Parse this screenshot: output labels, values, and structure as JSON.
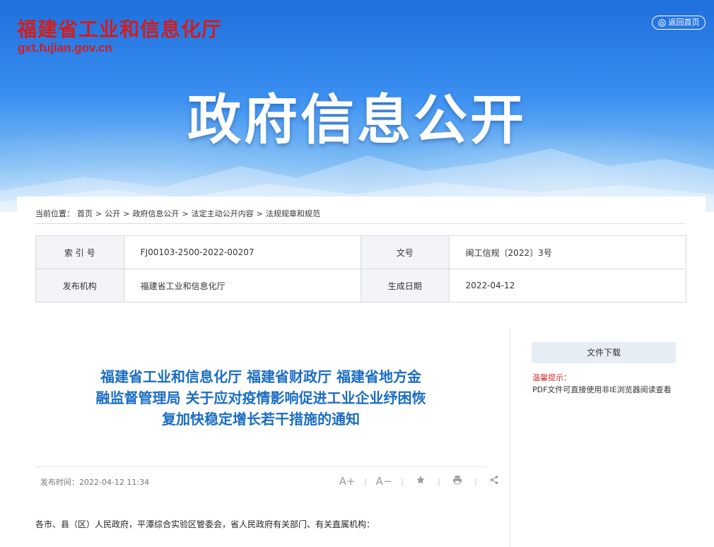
{
  "header": {
    "site_name": "福建省工业和信息化厅",
    "site_domain": "gxt.fujian.gov.cn",
    "home_button": "返回首页",
    "banner_title": "政府信息公开"
  },
  "breadcrumb": {
    "prefix": "当前位置：",
    "items": [
      "首页",
      "公开",
      "政府信息公开",
      "法定主动公开内容",
      "法规规章和规范"
    ],
    "separator": ">"
  },
  "meta_table": {
    "rows": [
      [
        {
          "label": "索 引 号",
          "value": "FJ00103-2500-2022-00207"
        },
        {
          "label": "文号",
          "value": "闽工信规〔2022〕3号"
        }
      ],
      [
        {
          "label": "发布机构",
          "value": "福建省工业和信息化厅"
        },
        {
          "label": "生成日期",
          "value": "2022-04-12"
        }
      ]
    ]
  },
  "article": {
    "title": "福建省工业和信息化厅 福建省财政厅 福建省地方金融监督管理局 关于应对疫情影响促进工业企业纾困恢复加快稳定增长若干措施的通知",
    "publish_time": "发布时间：2022-04-12 11:34",
    "tools": {
      "font_increase": "A+",
      "font_decrease": "A−",
      "separator": "|"
    },
    "first_line": "各市、县（区）人民政府，平潭综合实验区管委会，省人民政府有关部门、有关直属机构："
  },
  "sidebar": {
    "download_label": "文件下载",
    "tip_label": "温馨提示：",
    "tip_text": "PDF文件可直接使用非IE浏览器阅读查看"
  },
  "colors": {
    "brand_red": "#d21d1d",
    "title_blue": "#1a6cc4",
    "banner_blue": "#2f80e6"
  }
}
